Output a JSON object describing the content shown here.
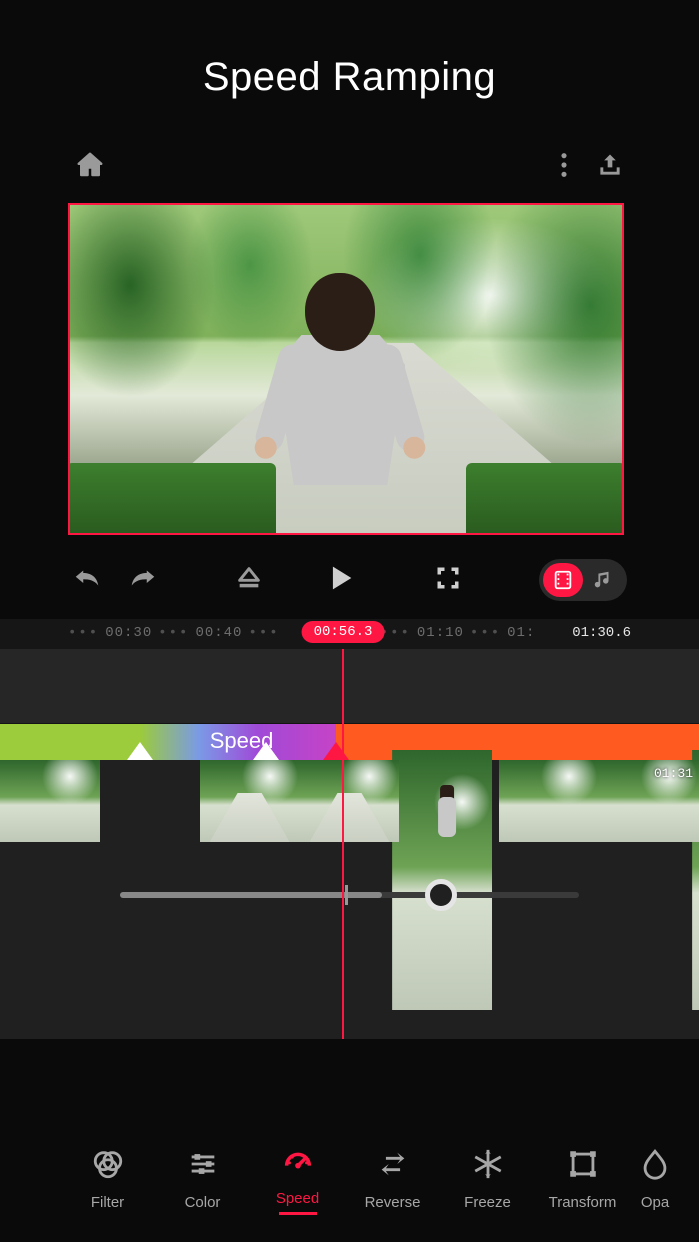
{
  "title": "Speed Ramping",
  "topbar": {
    "home_icon": "home-icon",
    "more_icon": "more-icon",
    "export_icon": "export-icon"
  },
  "controls": {
    "undo": "undo-icon",
    "redo": "redo-icon",
    "eject": "eject-icon",
    "play": "play-icon",
    "fullscreen": "fullscreen-icon",
    "video_mode": "film-icon",
    "music_mode": "music-icon"
  },
  "timeline": {
    "ticks": [
      "00:30",
      "00:40",
      "01:10",
      "01:"
    ],
    "current_time": "00:56.3",
    "total_time": "01:30.6",
    "speed_label": "Speed",
    "clip_end_label": "01:31"
  },
  "slider": {
    "value_pct": 70,
    "center_tick_pct": 49
  },
  "tools": [
    {
      "id": "filter",
      "label": "Filter",
      "icon": "filter-icon",
      "active": false
    },
    {
      "id": "color",
      "label": "Color",
      "icon": "sliders-icon",
      "active": false
    },
    {
      "id": "speed",
      "label": "Speed",
      "icon": "gauge-icon",
      "active": true
    },
    {
      "id": "reverse",
      "label": "Reverse",
      "icon": "reverse-icon",
      "active": false
    },
    {
      "id": "freeze",
      "label": "Freeze",
      "icon": "snowflake-icon",
      "active": false
    },
    {
      "id": "transform",
      "label": "Transform",
      "icon": "transform-icon",
      "active": false
    },
    {
      "id": "opacity",
      "label": "Opa",
      "icon": "droplet-icon",
      "active": false
    }
  ],
  "colors": {
    "accent": "#ff1744",
    "orange": "#ff5a1f",
    "lime": "#9ccb3b"
  }
}
